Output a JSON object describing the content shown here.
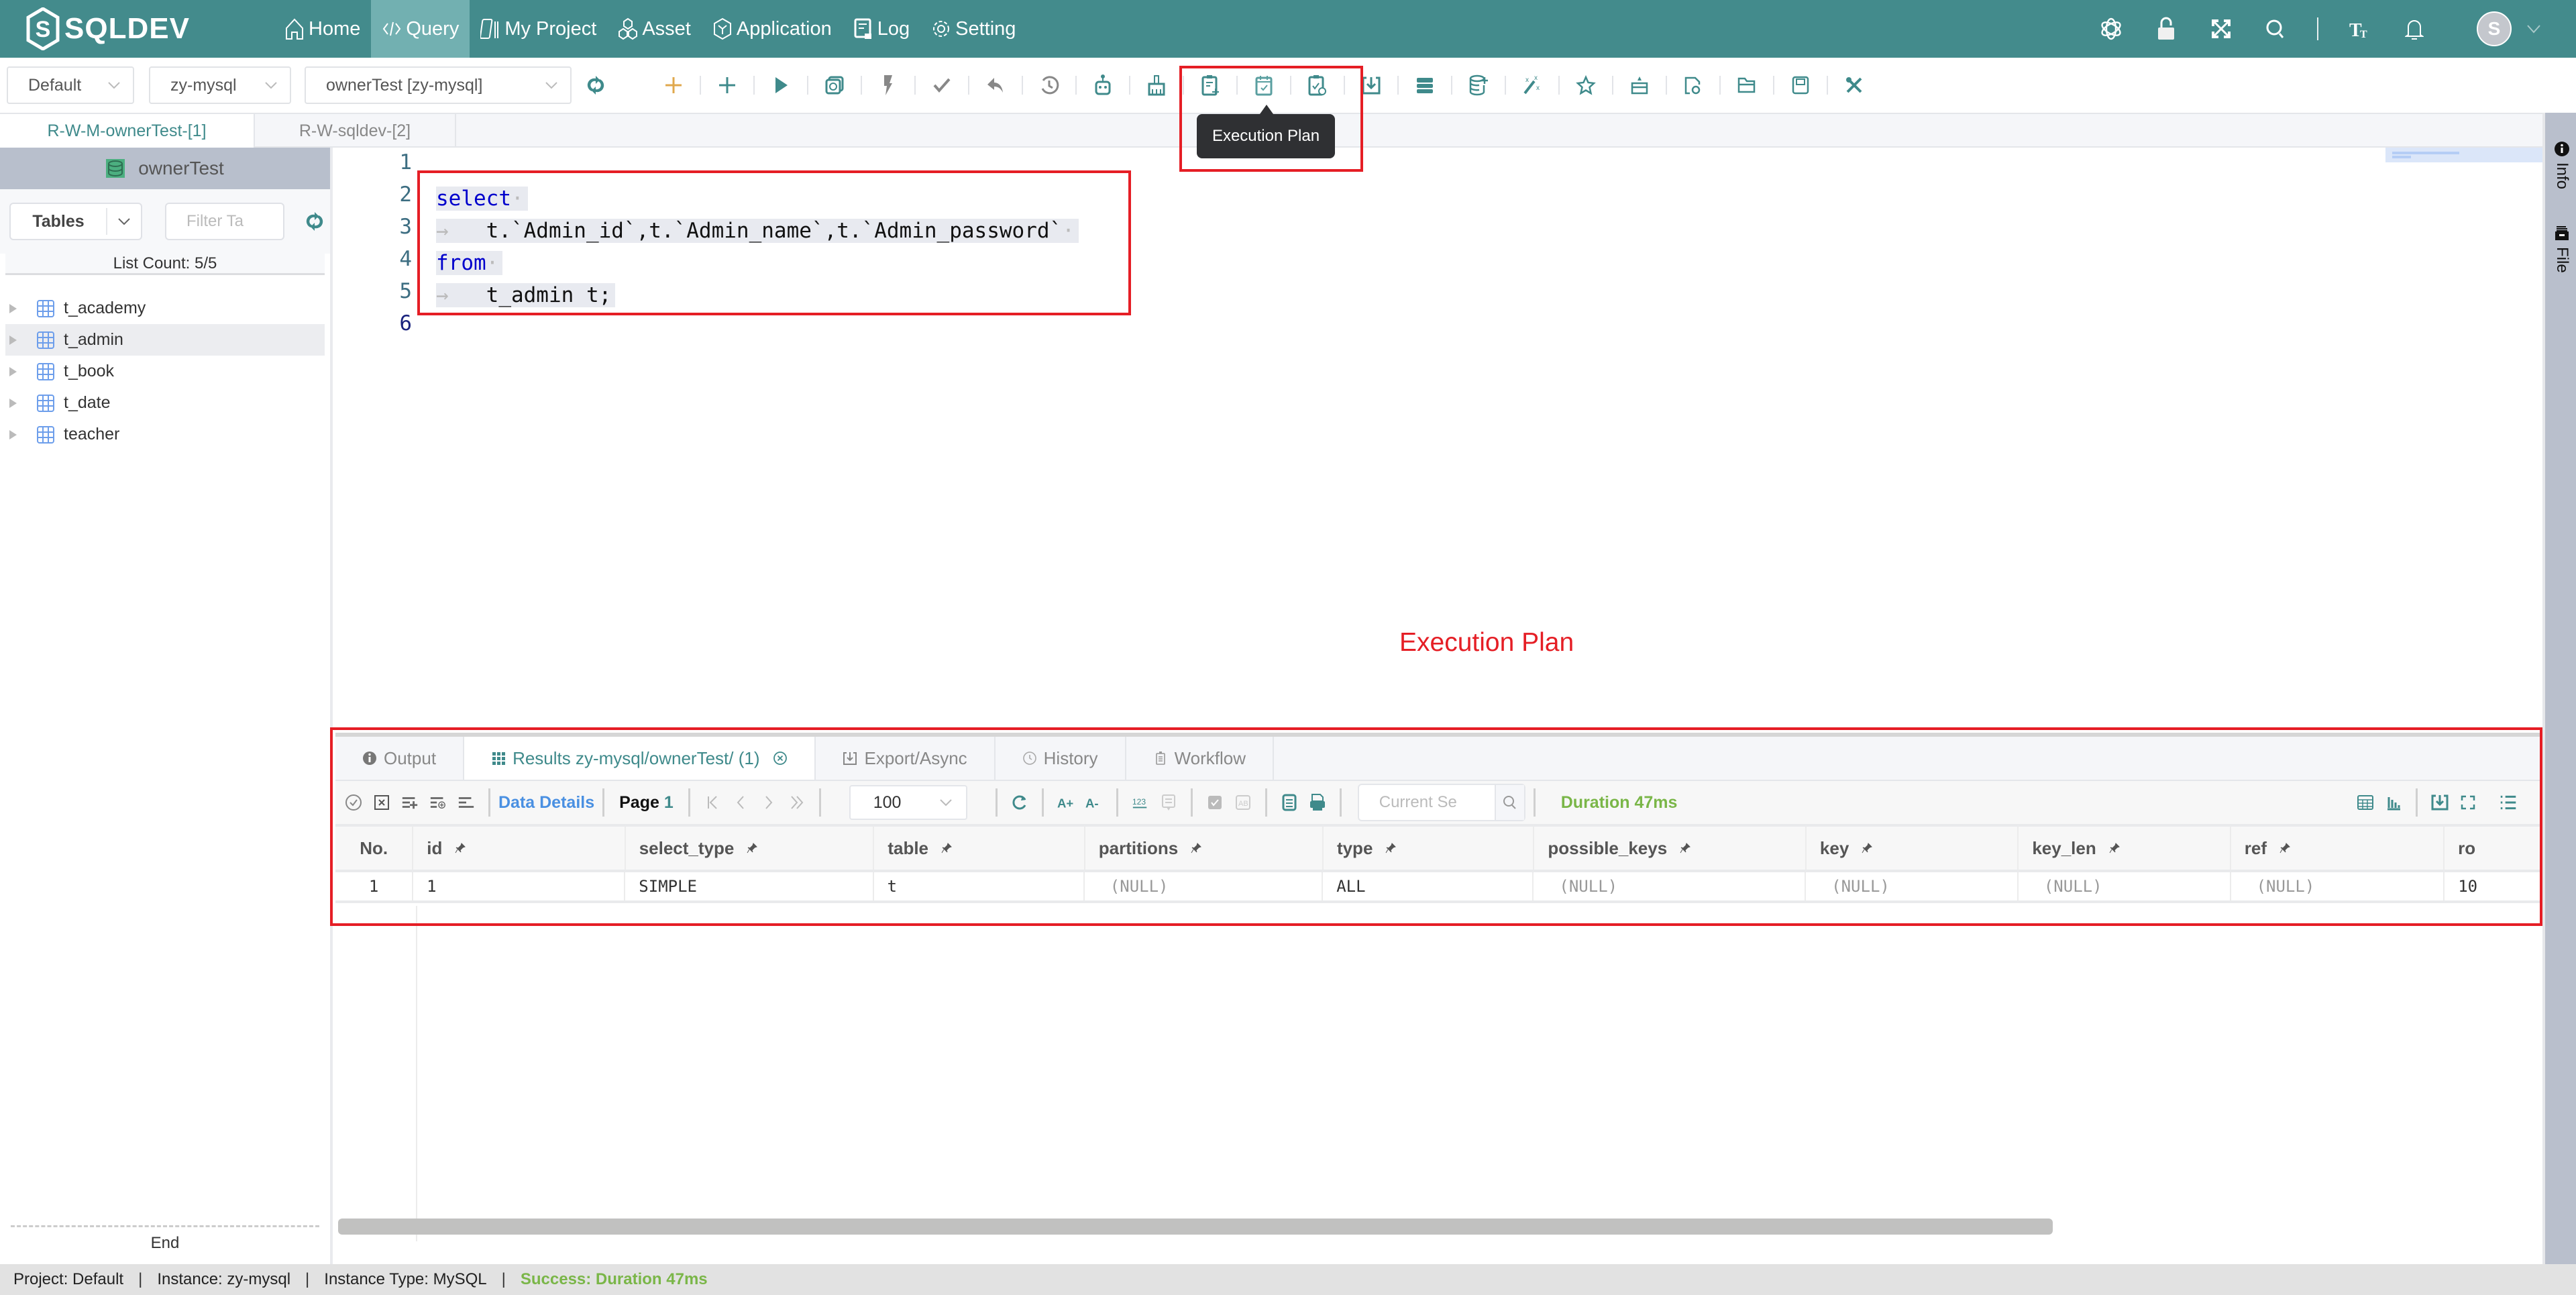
{
  "app": {
    "logo_text": "SQLDEV"
  },
  "nav": {
    "items": [
      {
        "label": "Home",
        "icon": "home-icon"
      },
      {
        "label": "Query",
        "icon": "code-icon",
        "active": true
      },
      {
        "label": "My Project",
        "icon": "project-icon"
      },
      {
        "label": "Asset",
        "icon": "asset-icon"
      },
      {
        "label": "Application",
        "icon": "application-icon"
      },
      {
        "label": "Log",
        "icon": "log-icon"
      },
      {
        "label": "Setting",
        "icon": "gear-icon"
      }
    ],
    "right_icons": [
      "ai-assistant-icon",
      "lock-icon",
      "fullscreen-icon",
      "search-icon",
      "font-size-icon",
      "bell-icon"
    ],
    "avatar_letter": "S"
  },
  "toolbar": {
    "project_select": "Default",
    "instance_select": "zy-mysql",
    "database_select": "ownerTest [zy-mysql]",
    "icons": [
      "new-query-icon",
      "add-icon",
      "run-icon",
      "run-explain-icon",
      "quick-run-icon",
      "commit-icon",
      "rollback-icon",
      "history-icon",
      "ai-robot-icon",
      "format-brush-icon",
      "sql-template-icon",
      "execution-plan-icon",
      "sql-review-icon",
      "import-icon",
      "data-table-icon",
      "add-database-icon",
      "magic-wand-icon",
      "favorite-icon",
      "snippet-icon",
      "file-link-icon",
      "open-folder-icon",
      "save-icon",
      "tools-icon"
    ],
    "tooltip": "Execution Plan"
  },
  "editor_tabs": [
    {
      "label": "R-W-M-ownerTest-[1]",
      "active": true
    },
    {
      "label": "R-W-sqldev-[2]",
      "active": false
    }
  ],
  "sidebar": {
    "database": "ownerTest",
    "object_type": "Tables",
    "filter_placeholder": "Filter Ta",
    "list_count_label": "List Count:",
    "list_count": "5/5",
    "tables": [
      "t_academy",
      "t_admin",
      "t_book",
      "t_date",
      "teacher"
    ],
    "selected_table": "t_admin",
    "end_label": "End"
  },
  "editor": {
    "lines": [
      "",
      "select",
      "t.`Admin_id`,t.`Admin_name`,t.`Admin_password`",
      "from",
      "t_admin t;",
      ""
    ],
    "line_numbers": [
      "1",
      "2",
      "3",
      "4",
      "5",
      "6"
    ]
  },
  "annotation": {
    "label": "Execution Plan"
  },
  "right_rail": {
    "items": [
      {
        "label": "Info",
        "icon": "info-icon"
      },
      {
        "label": "File",
        "icon": "file-icon"
      }
    ]
  },
  "results": {
    "tabs": [
      {
        "label": "Output",
        "icon": "info-icon"
      },
      {
        "label": "Results zy-mysql/ownerTest/  (1)",
        "icon": "grid-icon",
        "active": true,
        "closable": true
      },
      {
        "label": "Export/Async",
        "icon": "export-icon"
      },
      {
        "label": "History",
        "icon": "clock-icon"
      },
      {
        "label": "Workflow",
        "icon": "workflow-icon"
      }
    ],
    "toolbar": {
      "data_details": "Data Details",
      "page_label": "Page",
      "page_number": "1",
      "page_size": "100",
      "search_placeholder": "Current Se",
      "duration": "Duration 47ms"
    },
    "columns": [
      "No.",
      "id",
      "select_type",
      "table",
      "partitions",
      "type",
      "possible_keys",
      "key",
      "key_len",
      "ref",
      "ro"
    ],
    "rows": [
      [
        "1",
        "1",
        "SIMPLE",
        "t",
        "(NULL)",
        "ALL",
        "(NULL)",
        "(NULL)",
        "(NULL)",
        "(NULL)",
        "10"
      ]
    ]
  },
  "statusbar": {
    "project": "Project: Default",
    "instance": "Instance: zy-mysql",
    "instance_type": "Instance Type: MySQL",
    "status": "Success: Duration 47ms"
  },
  "colors": {
    "brand": "#438b8c",
    "accent_teal": "#3f8a8b",
    "success": "#7ab648",
    "annotation_red": "#e51e25",
    "keyword_blue": "#0000cc"
  }
}
